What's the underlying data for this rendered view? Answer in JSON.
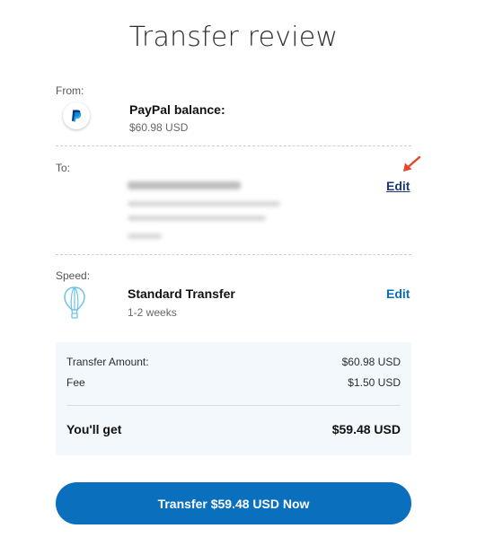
{
  "header": {
    "title": "Transfer review"
  },
  "from": {
    "label": "From:",
    "source_name": "PayPal balance:",
    "source_amount": "$60.98 USD",
    "icon": "paypal-logo"
  },
  "to": {
    "label": "To:",
    "edit_label": "Edit"
  },
  "speed": {
    "label": "Speed:",
    "option_title": "Standard Transfer",
    "option_duration": "1-2 weeks",
    "icon": "hot-air-balloon-icon",
    "edit_label": "Edit"
  },
  "summary": {
    "transfer_amount_label": "Transfer Amount:",
    "transfer_amount_value": "$60.98 USD",
    "fee_label": "Fee",
    "fee_value": "$1.50 USD",
    "youll_get_label": "You'll get",
    "youll_get_value": "$59.48 USD"
  },
  "actions": {
    "transfer_button": "Transfer $59.48 USD Now"
  },
  "colors": {
    "brand_blue": "#0a6fbd",
    "link_dark": "#1b3a74",
    "summary_bg": "#f3f8fc",
    "annotation_arrow": "#e8442a"
  }
}
